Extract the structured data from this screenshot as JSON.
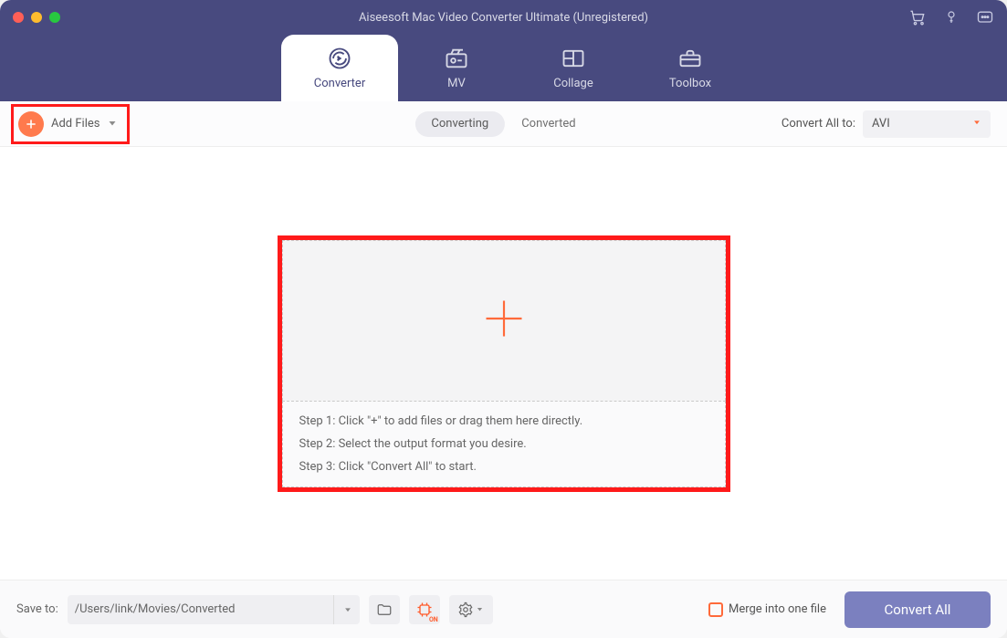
{
  "window": {
    "title": "Aiseesoft Mac Video Converter Ultimate (Unregistered)"
  },
  "tabs": {
    "converter": "Converter",
    "mv": "MV",
    "collage": "Collage",
    "toolbox": "Toolbox"
  },
  "toolbar": {
    "add_files": "Add Files",
    "seg_converting": "Converting",
    "seg_converted": "Converted",
    "convert_all_to_label": "Convert All to:",
    "convert_all_to_value": "AVI"
  },
  "dropzone": {
    "step1": "Step 1: Click \"+\" to add files or drag them here directly.",
    "step2": "Step 2: Select the output format you desire.",
    "step3": "Step 3: Click \"Convert All\" to start."
  },
  "bottom": {
    "save_to_label": "Save to:",
    "save_to_path": "/Users/link/Movies/Converted",
    "merge_label": "Merge into one file",
    "convert_all": "Convert All"
  }
}
